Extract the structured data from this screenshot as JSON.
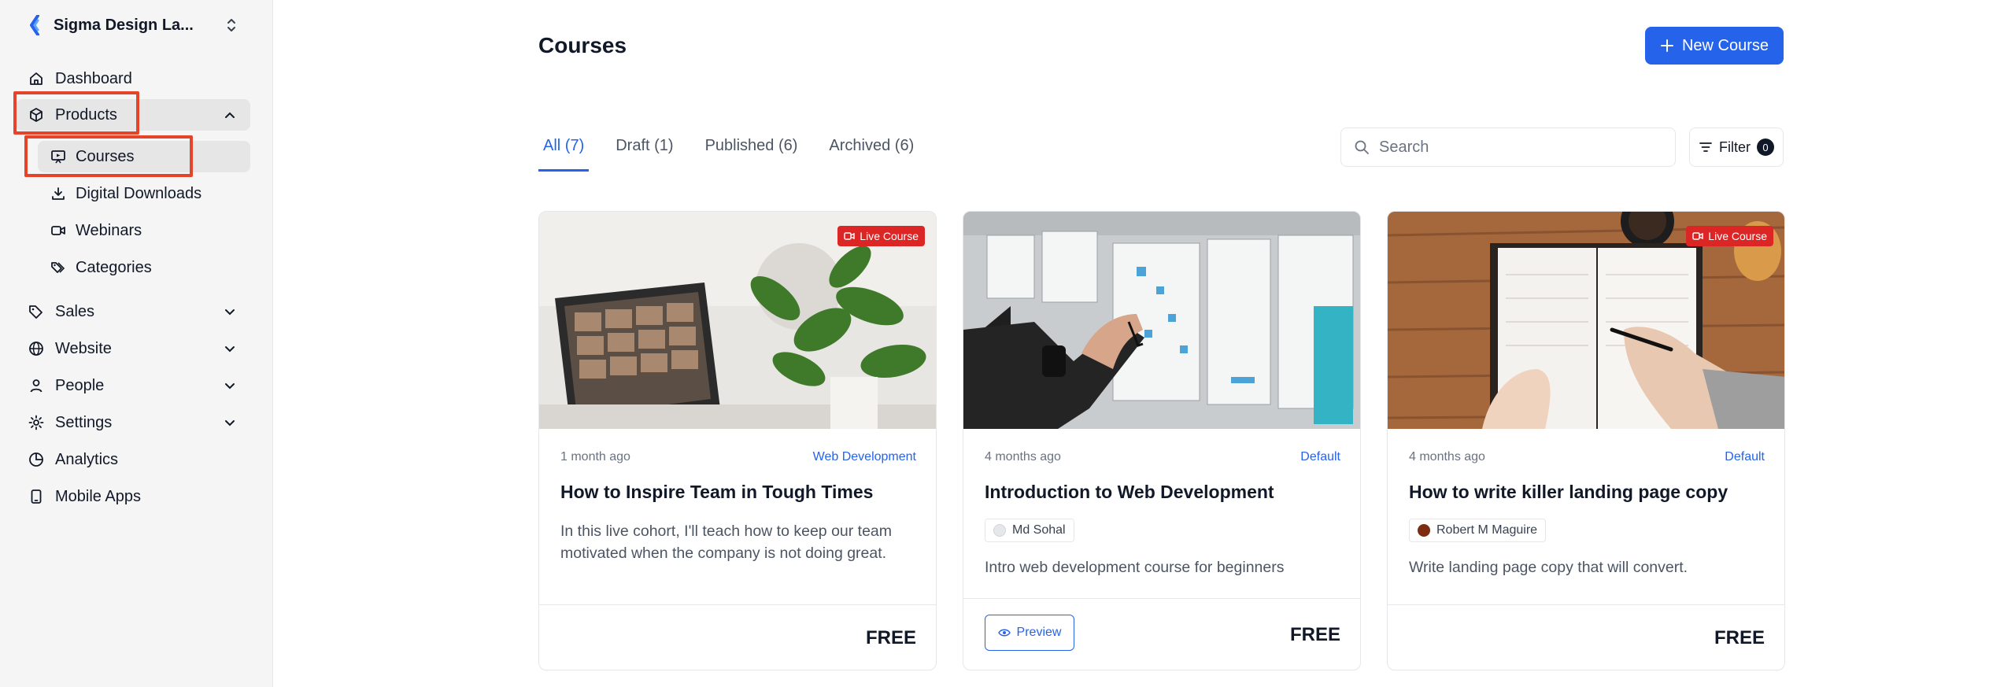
{
  "sidebar": {
    "brand": "Sigma Design La...",
    "items": [
      {
        "label": "Dashboard",
        "icon": "home-icon"
      },
      {
        "label": "Products",
        "icon": "box-icon"
      },
      {
        "label": "Sales",
        "icon": "tag-icon"
      },
      {
        "label": "Website",
        "icon": "globe-icon"
      },
      {
        "label": "People",
        "icon": "user-icon"
      },
      {
        "label": "Settings",
        "icon": "gear-icon"
      },
      {
        "label": "Analytics",
        "icon": "pie-chart-icon"
      },
      {
        "label": "Mobile Apps",
        "icon": "mobile-icon"
      }
    ],
    "products_sub": [
      {
        "label": "Courses",
        "icon": "presentation-icon"
      },
      {
        "label": "Digital Downloads",
        "icon": "download-icon"
      },
      {
        "label": "Webinars",
        "icon": "video-icon"
      },
      {
        "label": "Categories",
        "icon": "tags-icon"
      }
    ]
  },
  "header": {
    "title": "Courses",
    "new_button": "New Course"
  },
  "tabs": [
    {
      "label": "All (7)",
      "active": true
    },
    {
      "label": "Draft (1)",
      "active": false
    },
    {
      "label": "Published (6)",
      "active": false
    },
    {
      "label": "Archived (6)",
      "active": false
    }
  ],
  "search": {
    "placeholder": "Search"
  },
  "filter": {
    "label": "Filter",
    "count": "0"
  },
  "cards": [
    {
      "live_badge": "Live Course",
      "time": "1 month ago",
      "category": "Web Development",
      "title": "How to Inspire Team in Tough Times",
      "description": "In this live cohort, I'll teach how to keep our team motivated when the company is not doing great.",
      "price": "FREE"
    },
    {
      "time": "4 months ago",
      "category": "Default",
      "title": "Introduction to Web Development",
      "author": "Md Sohal",
      "description": "Intro web development course for beginners",
      "preview": "Preview",
      "price": "FREE"
    },
    {
      "live_badge": "Live Course",
      "time": "4 months ago",
      "category": "Default",
      "title": "How to write killer landing page copy",
      "author": "Robert M Maguire",
      "description": "Write landing page copy that will convert.",
      "price": "FREE"
    }
  ],
  "colors": {
    "accent": "#2563eb",
    "live": "#dc2626",
    "highlight": "#e4442a"
  }
}
